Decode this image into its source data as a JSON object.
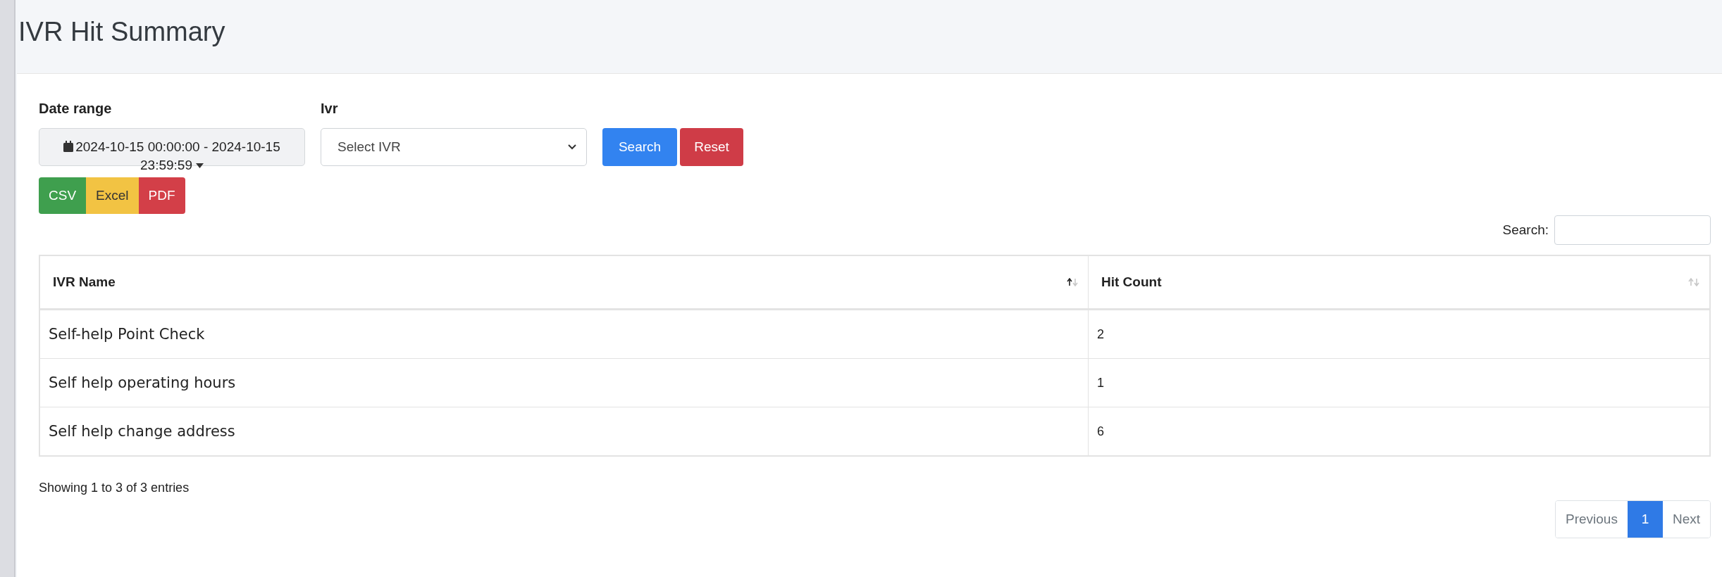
{
  "page_title": "IVR Hit Summary",
  "filters": {
    "date_range": {
      "label": "Date range",
      "value": "2024-10-15 00:00:00 - 2024-10-15 23:59:59"
    },
    "ivr": {
      "label": "Ivr",
      "value": "Select IVR"
    }
  },
  "buttons": [
    {
      "label": "Search",
      "kind": "primary"
    },
    {
      "label": "Reset",
      "kind": "danger"
    }
  ],
  "export_buttons": [
    {
      "label": "CSV",
      "kind": "csv"
    },
    {
      "label": "Excel",
      "kind": "excel"
    },
    {
      "label": "PDF",
      "kind": "pdf"
    }
  ],
  "table_search": {
    "label": "Search:"
  },
  "table": {
    "columns": [
      {
        "label": "IVR Name",
        "sorted": true
      },
      {
        "label": "Hit Count",
        "sorted": false
      }
    ],
    "rows": [
      [
        "Self-help Point Check",
        "2"
      ],
      [
        "Self help operating hours",
        "1"
      ],
      [
        "Self help change address",
        "6"
      ]
    ]
  },
  "info": "Showing 1 to 3 of 3 entries",
  "pagination": [
    {
      "label": "Previous",
      "selected": false
    },
    {
      "label": "1",
      "selected": true
    },
    {
      "label": "Next",
      "selected": false
    }
  ]
}
